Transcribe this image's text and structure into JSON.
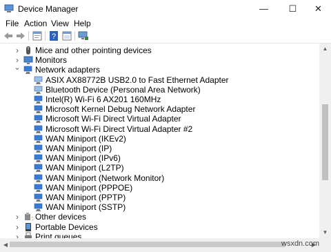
{
  "window": {
    "title": "Device Manager",
    "minimize": "—",
    "maximize": "☐",
    "close": "✕"
  },
  "menu": [
    "File",
    "Action",
    "View",
    "Help"
  ],
  "toolbar": {
    "buttons": [
      "back-arrow-icon",
      "forward-arrow-icon",
      "properties-icon",
      "help-icon",
      "show-hidden-icon",
      "scan-hardware-icon"
    ]
  },
  "tree": {
    "categories_top": [
      {
        "label": "Mice and other pointing devices",
        "icon": "mouse-icon",
        "expanded": false
      },
      {
        "label": "Monitors",
        "icon": "monitor-icon",
        "expanded": false
      },
      {
        "label": "Network adapters",
        "icon": "network-adapter-icon",
        "expanded": true
      }
    ],
    "network_adapters": [
      "ASIX AX88772B USB2.0 to Fast Ethernet Adapter",
      "Bluetooth Device (Personal Area Network)",
      "Intel(R) Wi-Fi 6 AX201 160MHz",
      "Microsoft Kernel Debug Network Adapter",
      "Microsoft Wi-Fi Direct Virtual Adapter",
      "Microsoft Wi-Fi Direct Virtual Adapter #2",
      "WAN Miniport (IKEv2)",
      "WAN Miniport (IP)",
      "WAN Miniport (IPv6)",
      "WAN Miniport (L2TP)",
      "WAN Miniport (Network Monitor)",
      "WAN Miniport (PPPOE)",
      "WAN Miniport (PPTP)",
      "WAN Miniport (SSTP)"
    ],
    "categories_bottom": [
      {
        "label": "Other devices",
        "icon": "other-devices-icon",
        "expanded": false
      },
      {
        "label": "Portable Devices",
        "icon": "portable-devices-icon",
        "expanded": false
      },
      {
        "label": "Print queues",
        "icon": "print-queue-icon",
        "expanded": false
      }
    ]
  },
  "watermark": "wsxdn.com",
  "colors": {
    "accent": "#0b66b8",
    "adapter": "#3a7bd5",
    "adapter_faded": "#9cbfe6"
  }
}
